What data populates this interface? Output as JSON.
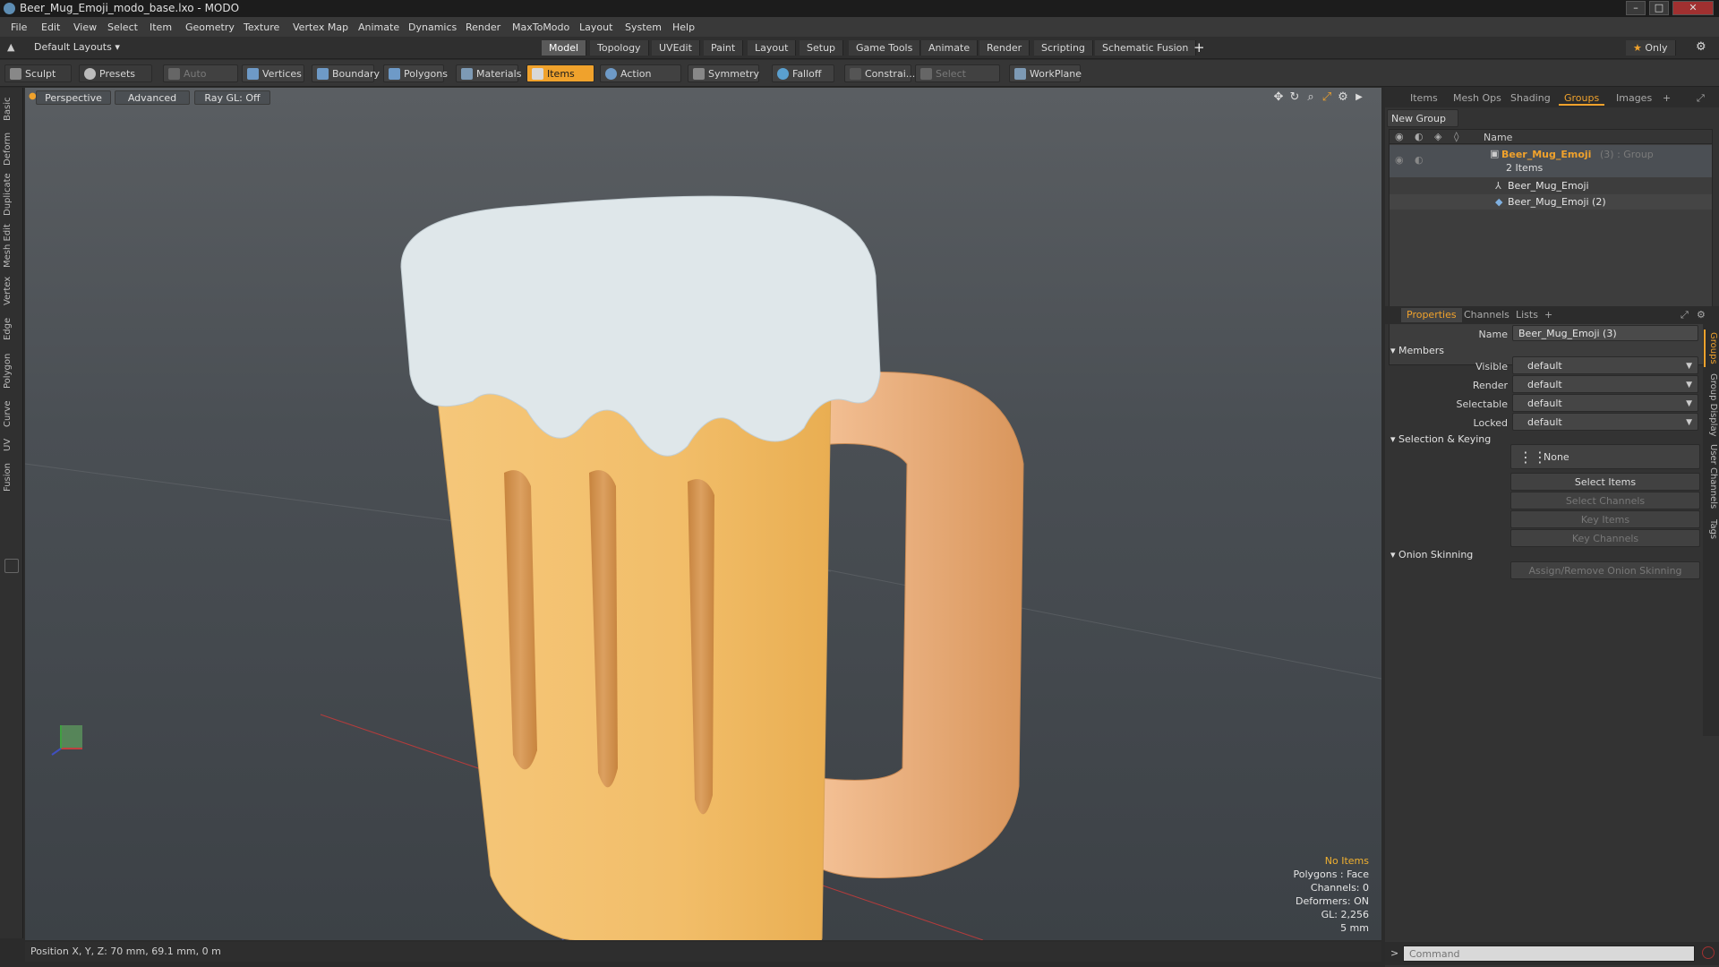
{
  "window": {
    "title": "Beer_Mug_Emoji_modo_base.lxo - MODO"
  },
  "menu": [
    "File",
    "Edit",
    "View",
    "Select",
    "Item",
    "Geometry",
    "Texture",
    "Vertex Map",
    "Animate",
    "Dynamics",
    "Render",
    "MaxToModo",
    "Layout",
    "System",
    "Help"
  ],
  "layout_selector": "Default Layouts",
  "layout_tabs": [
    "Model",
    "Topology",
    "UVEdit",
    "Paint",
    "Layout",
    "Setup",
    "Game Tools",
    "Animate",
    "Render",
    "Scripting",
    "Schematic Fusion"
  ],
  "layout_tab_active": "Model",
  "only_label": "Only",
  "toolbar": {
    "sculpt": "Sculpt",
    "presets": "Presets",
    "auto_select": "Auto Select",
    "vertices": "Vertices",
    "boundary": "Boundary",
    "polygons": "Polygons",
    "materials": "Materials",
    "items": "Items",
    "action_center": "Action Center",
    "symmetry": "Symmetry",
    "falloff": "Falloff",
    "constraints": "Constrai...",
    "select_through": "Select Through",
    "workplane": "WorkPlane"
  },
  "left_tabs": [
    "Basic",
    "Deform",
    "Duplicate",
    "Mesh Edit",
    "Vertex",
    "Edge",
    "Polygon",
    "Curve",
    "UV",
    "Fusion"
  ],
  "viewport": {
    "perspective": "Perspective",
    "advanced": "Advanced",
    "raygl": "Ray GL: Off",
    "stats": {
      "no_items": "No Items",
      "polygons": "Polygons : Face",
      "channels": "Channels: 0",
      "deformers": "Deformers: ON",
      "gl": "GL: 2,256",
      "scale": "5 mm"
    }
  },
  "status": {
    "position": "Position X, Y, Z:  70 mm, 69.1 mm, 0 m"
  },
  "panel_tabs": [
    "Items",
    "Mesh Ops",
    "Shading",
    "Groups",
    "Images"
  ],
  "panel_tab_active": "Groups",
  "groups": {
    "new_group": "New Group",
    "col_name": "Name",
    "group_name": "Beer_Mug_Emoji",
    "group_suffix": "(3) : Group",
    "item_count": "2 Items",
    "children": [
      "Beer_Mug_Emoji",
      "Beer_Mug_Emoji (2)"
    ]
  },
  "props_tabs": [
    "Properties",
    "Channels",
    "Lists"
  ],
  "props": {
    "name_label": "Name",
    "name_value": "Beer_Mug_Emoji (3)",
    "members": "Members",
    "visible_label": "Visible",
    "render_label": "Render",
    "selectable_label": "Selectable",
    "locked_label": "Locked",
    "visible": "default",
    "render": "default",
    "selectable": "default",
    "locked": "default",
    "sel_keying": "Selection & Keying",
    "none": "None",
    "select_items": "Select Items",
    "select_channels": "Select Channels",
    "key_items": "Key Items",
    "key_channels": "Key Channels",
    "onion": "Onion Skinning",
    "onion_btn": "Assign/Remove Onion Skinning"
  },
  "side_tabs": [
    "Groups",
    "Group Display",
    "User Channels",
    "Tags"
  ],
  "command_placeholder": "Command",
  "colors": {
    "accent": "#f0a22c",
    "foam": "#dfe7ea",
    "beer": "#f2be6a",
    "handle": "#f0b27a"
  }
}
